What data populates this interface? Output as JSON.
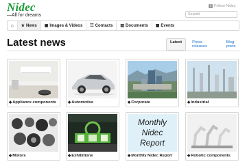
{
  "brand": {
    "name": "Nidec",
    "tagline": "—All for dreams",
    "color": "#1e9b3a"
  },
  "header": {
    "follow_label": "Follow Nidec",
    "follow_badge": "f",
    "search_placeholder": "Search"
  },
  "nav": {
    "home_icon": "⌂",
    "items": [
      {
        "icon": "★",
        "label": "News"
      },
      {
        "icon": "▣",
        "label": "Images & Videos"
      },
      {
        "icon": "☷",
        "label": "Contacts"
      },
      {
        "icon": "▤",
        "label": "Documents"
      },
      {
        "icon": "▦",
        "label": "Events"
      }
    ]
  },
  "page": {
    "title": "Latest news"
  },
  "subtabs": [
    "Latest",
    "Press releases",
    "Blog posts"
  ],
  "tag_icon": "◆",
  "cards": [
    {
      "label": "Appliance components"
    },
    {
      "label": "Automotive"
    },
    {
      "label": "Corporate"
    },
    {
      "label": "Industrial"
    },
    {
      "label": "Motors"
    },
    {
      "label": "Exhibitions"
    },
    {
      "label": "Monthly Nidec Report",
      "image_text": [
        "Monthly",
        "Nidec",
        "Report"
      ]
    },
    {
      "label": "Robotic components"
    }
  ]
}
